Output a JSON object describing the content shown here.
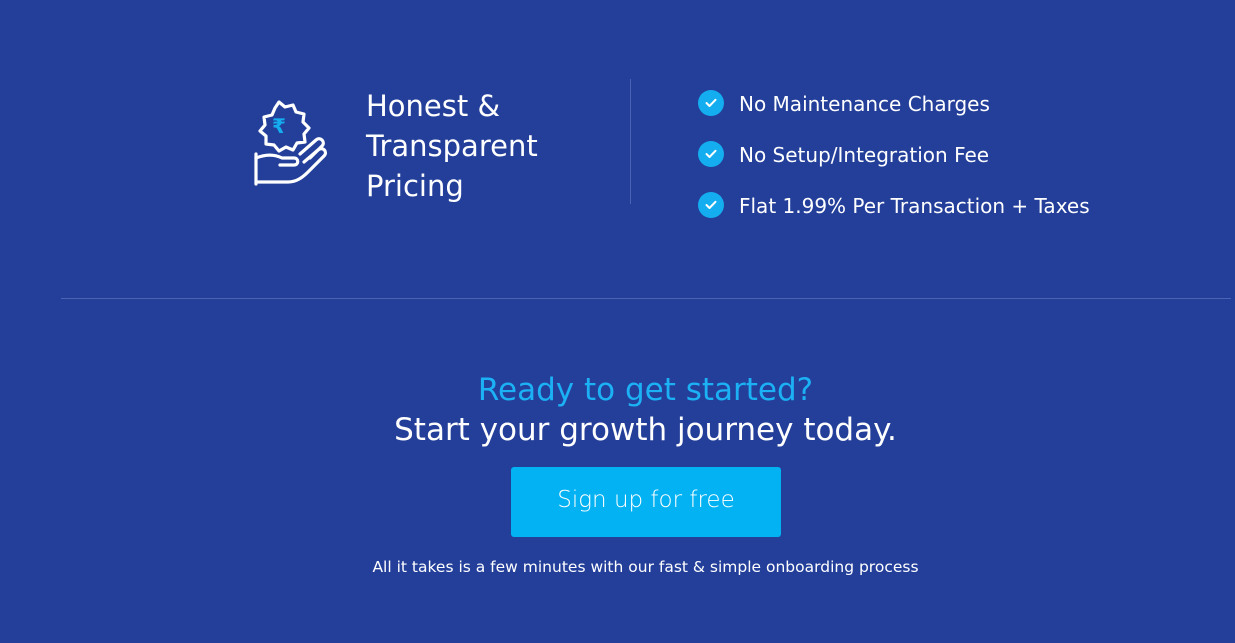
{
  "pricing": {
    "icon": "rupee-badge-hand-icon",
    "currency_symbol": "₹",
    "title": "Honest & Transparent Pricing",
    "features": [
      {
        "icon": "check-circle-icon",
        "label": "No Maintenance Charges"
      },
      {
        "icon": "check-circle-icon",
        "label": "No Setup/Integration Fee"
      },
      {
        "icon": "check-circle-icon",
        "label": "Flat 1.99% Per Transaction + Taxes"
      }
    ]
  },
  "cta": {
    "kicker": "Ready to get started?",
    "headline": "Start your growth journey today.",
    "button_label": "Sign up for free",
    "note": "All it takes is a few minutes with our fast & simple onboarding process"
  },
  "colors": {
    "background": "#233f9a",
    "accent": "#14aef0",
    "button": "#03b2f3",
    "divider": "#4a64b3"
  }
}
